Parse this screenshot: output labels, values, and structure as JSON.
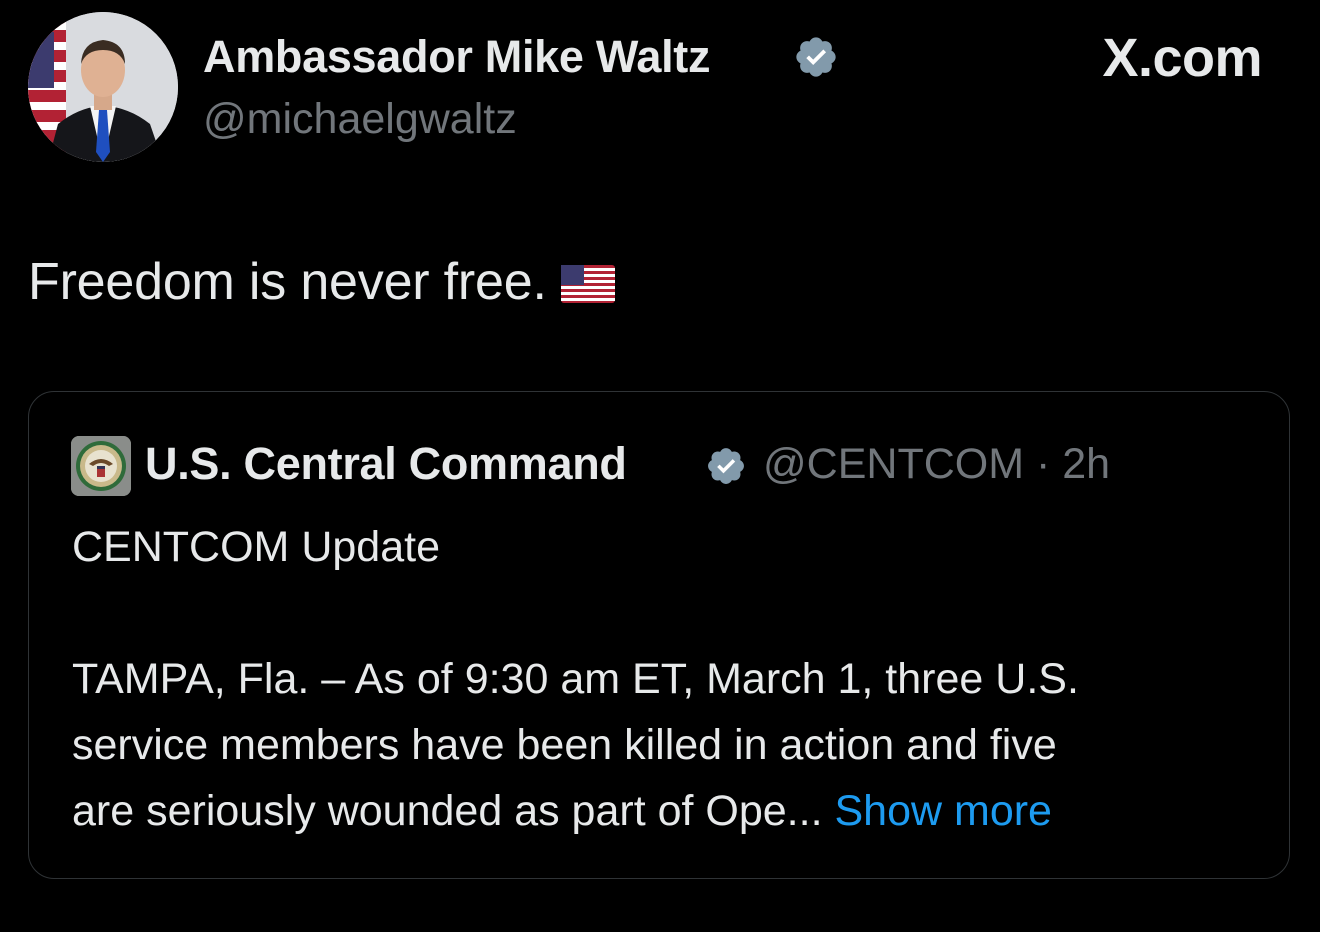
{
  "author": {
    "display_name": "Ambassador Mike Waltz",
    "handle": "@michaelgwaltz",
    "verified_icon": "verified-badge-icon",
    "avatar_icon": "profile-photo"
  },
  "brand": {
    "label": "X.com"
  },
  "tweet": {
    "text": "Freedom is never free.",
    "emoji_icon": "us-flag-emoji"
  },
  "quote": {
    "display_name": "U.S. Central Command",
    "handle": "@CENTCOM",
    "separator": " · ",
    "time": "2h",
    "title": "CENTCOM Update",
    "lines": [
      "TAMPA, Fla. – As of 9:30 am ET, March 1, three U.S.",
      "service members have been killed in action and five",
      "are seriously wounded as part of Ope..."
    ],
    "show_more": "Show more"
  },
  "colors": {
    "background": "#000000",
    "text_primary": "#e7e9ea",
    "text_secondary": "#71767b",
    "link": "#1d9bf0",
    "border": "#2f3336",
    "verified": "#829aab"
  }
}
